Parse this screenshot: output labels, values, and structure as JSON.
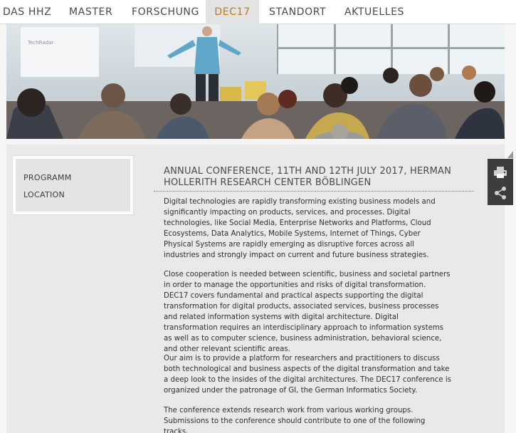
{
  "nav": {
    "items": [
      {
        "label": "DAS HHZ"
      },
      {
        "label": "MASTER"
      },
      {
        "label": "FORSCHUNG"
      },
      {
        "label": "DEC17"
      },
      {
        "label": "STANDORT"
      },
      {
        "label": "AKTUELLES"
      }
    ],
    "active": "DEC17",
    "active_color": "#c07a1a"
  },
  "hero": {
    "projection_text": "TechRadar"
  },
  "subnav": {
    "items": [
      {
        "label": "PROGRAMM"
      },
      {
        "label": "LOCATION"
      }
    ]
  },
  "article": {
    "title": "ANNUAL CONFERENCE, 11TH AND 12TH JULY 2017, HERMAN HOLLERITH RESEARCH CENTER BÖBLINGEN",
    "paragraphs": [
      "Digital technologies are rapidly transforming existing business models and significantly impacting on products, services, and processes. Digital technologies, like Social Media, Enterprise Networks and Platforms, Cloud Ecosystems, Data Analytics, Mobile Systems, Internet of Things, Cyber Physical Systems are rapidly emerging as disruptive forces across all industries and strongly impact on current and future business strategies.",
      "Close cooperation is needed between scientific, business and societal partners in order to manage the opportunities and risks of digital transformation. DEC17 covers fundamental and practical aspects supporting the digital transformation for digital products, associated services, business processes and related information systems with digital architecture. Digital transformation requires an interdisciplinary approach to information systems as well as to computer science, business administration, behavioral science, and other relevant scientific areas.",
      "Our aim is to provide a platform for researchers and practitioners to discuss both technological and business aspects of the digital transformation and take a deep look to the insides of the digital architectures. The DEC17 conference is organized under the patronage of GI, the German Informatics Society.",
      "The conference extends research work from various working groups. Submissions to the conference should contribute to one of the following tracks."
    ]
  },
  "tools": {
    "print_icon": "printer-icon",
    "share_icon": "share-icon"
  }
}
